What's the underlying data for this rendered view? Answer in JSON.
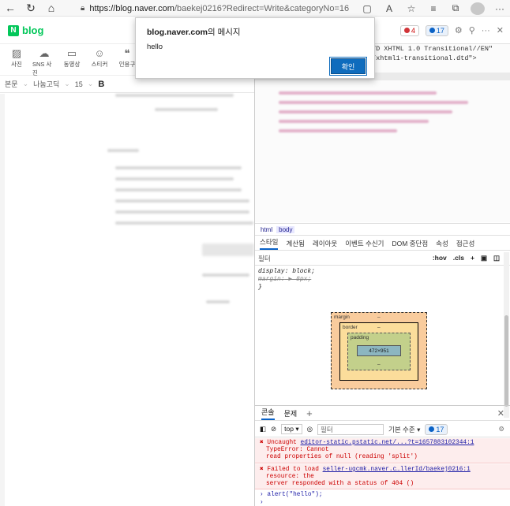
{
  "browser": {
    "url_host": "https://blog.naver.com",
    "url_rest": "/baekej0216?Redirect=Write&categoryNo=16"
  },
  "blog": {
    "logo": "blog",
    "tools": [
      "사진",
      "SNS 사진",
      "동영상",
      "스티커",
      "인용구"
    ],
    "format": {
      "style": "본문",
      "font": "나눔고딕",
      "size": "15",
      "bold": "B"
    }
  },
  "dialog": {
    "host": "blog.naver.com",
    "suffix": "의 메시지",
    "message": "hello",
    "ok_label": "확인"
  },
  "devtools": {
    "error_count": "4",
    "message_count": "17",
    "doctype_line1": "TD XHTML 1.0 Transitional//EN\"",
    "doctype_line2": "/xhtml1-transitional.dtd\">",
    "breadcrumbs": [
      "html",
      "body"
    ],
    "tabs": [
      "스타일",
      "계산됨",
      "레이아웃",
      "이벤트 수신기",
      "DOM 중단점",
      "속성",
      "접근성"
    ],
    "filter_placeholder": "필터",
    "filter_hov": ":hov",
    "filter_cls": ".cls",
    "style_line1": "display: block;",
    "style_line2": "margin:",
    "style_line2_val": "▶ 8px;",
    "style_line3": "}",
    "box": {
      "margin_label": "margin",
      "margin_value": "–",
      "border_label": "border",
      "border_value": "–",
      "padding_label": "padding",
      "padding_value": "–",
      "content": "472×951"
    },
    "drawer_tabs": [
      "콘솔",
      "문제"
    ],
    "console_context": "top",
    "console_filter": "필터",
    "console_level": "기본 수준",
    "console_badge": "17",
    "messages": [
      {
        "l1": "Uncaught",
        "link": "editor-static.pstatic.net/...?t=1657883102344:1",
        "l2": "TypeError: Cannot",
        "l3": "read properties of null (reading 'split')"
      },
      {
        "l1": "Failed to load",
        "link": "seller-ugcmk.naver.c…llerId/baekej0216:1",
        "l2": "resource: the",
        "l3": "server responded with a status of 404 ()"
      }
    ],
    "input_line": "alert(\"hello\");",
    "prompt": "›"
  }
}
